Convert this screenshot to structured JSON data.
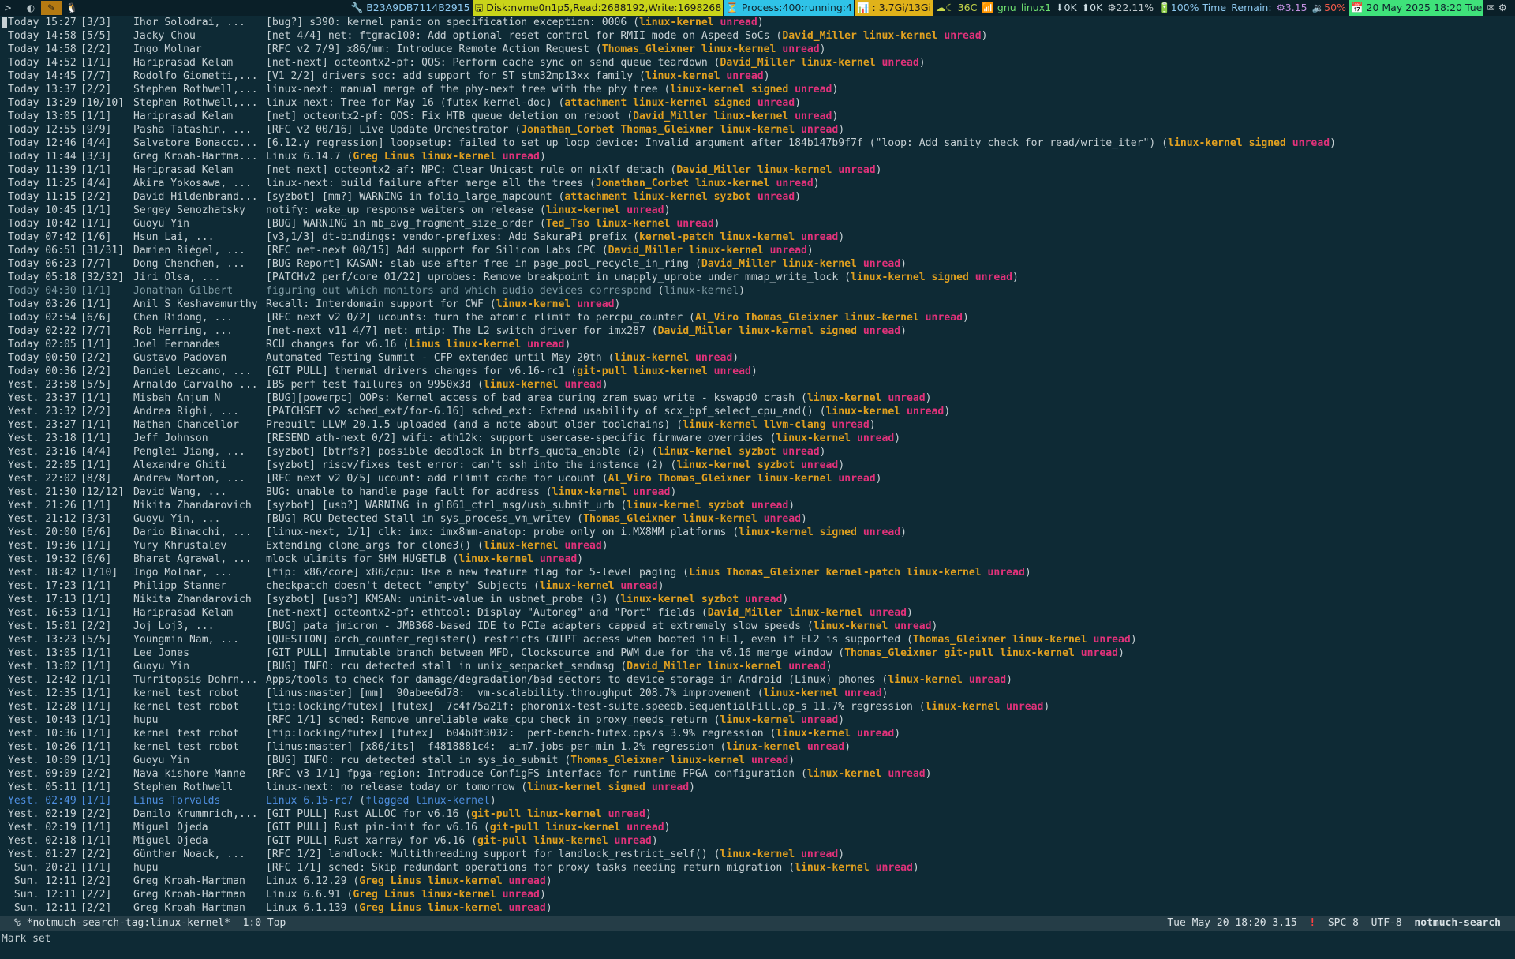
{
  "topbar": {
    "icons": [
      "terminal-icon",
      "emacs-icon",
      "firefox-icon",
      "penguin-icon"
    ],
    "icon_glyphs": [
      ">_",
      "◐",
      "✎",
      "🐧"
    ],
    "status": {
      "sha": "🔧 B23A9DB7114B2915",
      "disk": "🖫 Disk:nvme0n1p5,Read:2688192,Write:1698268",
      "process": "⏳ Process:400:running:4",
      "memory": "📊 : 3.7Gi/13Gi",
      "temp": "☁☾ 36C",
      "network": "📶 gnu_linux1",
      "down": "⬇0K",
      "up": "⬆0K",
      "cpu": "⚙22.11%",
      "battery": "🔋100% Time_Remain:",
      "load": "⚙3.15",
      "volume": "🔉50%",
      "date": "📅 20 May 2025 18:20 Tue",
      "mail": "✉ ⚙"
    }
  },
  "threads": [
    {
      "date": "Today 15:27",
      "count": "[3/3]",
      "author": "Ihor Solodrai, ...",
      "subject": "[bug?] s390: kernel panic on specification exception: 0006",
      "tags": [
        "linux-kernel",
        "unread"
      ]
    },
    {
      "date": "Today 14:58",
      "count": "[5/5]",
      "author": "Jacky Chou",
      "subject": "[net 4/4] net: ftgmac100: Add optional reset control for RMII mode on Aspeed SoCs",
      "tags": [
        "David_Miller",
        "linux-kernel",
        "unread"
      ]
    },
    {
      "date": "Today 14:58",
      "count": "[2/2]",
      "author": "Ingo Molnar",
      "subject": "[RFC v2 7/9] x86/mm: Introduce Remote Action Request",
      "tags": [
        "Thomas_Gleixner",
        "linux-kernel",
        "unread"
      ]
    },
    {
      "date": "Today 14:52",
      "count": "[1/1]",
      "author": "Hariprasad Kelam",
      "subject": "[net-next] octeontx2-pf: QOS: Perform cache sync on send queue teardown",
      "tags": [
        "David_Miller",
        "linux-kernel",
        "unread"
      ]
    },
    {
      "date": "Today 14:45",
      "count": "[7/7]",
      "author": "Rodolfo Giometti,...",
      "subject": "[V1 2/2] drivers soc: add support for ST stm32mp13xx family",
      "tags": [
        "linux-kernel",
        "unread"
      ]
    },
    {
      "date": "Today 13:37",
      "count": "[2/2]",
      "author": "Stephen Rothwell,...",
      "subject": "linux-next: manual merge of the phy-next tree with the phy tree",
      "tags": [
        "linux-kernel",
        "signed",
        "unread"
      ]
    },
    {
      "date": "Today 13:29",
      "count": "[10/10]",
      "author": "Stephen Rothwell,...",
      "subject": "linux-next: Tree for May 16 (futex kernel-doc)",
      "tags": [
        "attachment",
        "linux-kernel",
        "signed",
        "unread"
      ]
    },
    {
      "date": "Today 13:05",
      "count": "[1/1]",
      "author": "Hariprasad Kelam",
      "subject": "[net] octeontx2-pf: QOS: Fix HTB queue deletion on reboot",
      "tags": [
        "David_Miller",
        "linux-kernel",
        "unread"
      ]
    },
    {
      "date": "Today 12:55",
      "count": "[9/9]",
      "author": "Pasha Tatashin, ...",
      "subject": "[RFC v2 00/16] Live Update Orchestrator",
      "tags": [
        "Jonathan_Corbet",
        "Thomas_Gleixner",
        "linux-kernel",
        "unread"
      ]
    },
    {
      "date": "Today 12:46",
      "count": "[4/4]",
      "author": "Salvatore Bonacco...",
      "subject": "[6.12.y regression] loopsetup: failed to set up loop device: Invalid argument after 184b147b9f7f (\"loop: Add sanity check for read/write_iter\")",
      "tags": [
        "linux-kernel",
        "signed",
        "unread"
      ]
    },
    {
      "date": "Today 11:44",
      "count": "[3/3]",
      "author": "Greg Kroah-Hartma...",
      "subject": "Linux 6.14.7",
      "tags": [
        "Greg",
        "Linus",
        "linux-kernel",
        "unread"
      ]
    },
    {
      "date": "Today 11:39",
      "count": "[1/1]",
      "author": "Hariprasad Kelam",
      "subject": "[net-next] octeontx2-af: NPC: Clear Unicast rule on nixlf detach",
      "tags": [
        "David_Miller",
        "linux-kernel",
        "unread"
      ]
    },
    {
      "date": "Today 11:25",
      "count": "[4/4]",
      "author": "Akira Yokosawa, ...",
      "subject": "linux-next: build failure after merge all the trees",
      "tags": [
        "Jonathan_Corbet",
        "linux-kernel",
        "unread"
      ]
    },
    {
      "date": "Today 11:15",
      "count": "[2/2]",
      "author": "David Hildenbrand...",
      "subject": "[syzbot] [mm?] WARNING in folio_large_mapcount",
      "tags": [
        "attachment",
        "linux-kernel",
        "syzbot",
        "unread"
      ]
    },
    {
      "date": "Today 10:45",
      "count": "[1/1]",
      "author": "Sergey Senozhatsky",
      "subject": "notify: wake_up response waiters on release",
      "tags": [
        "linux-kernel",
        "unread"
      ]
    },
    {
      "date": "Today 10:42",
      "count": "[1/1]",
      "author": "Guoyu Yin",
      "subject": "[BUG] WARNING in mb_avg_fragment_size_order",
      "tags": [
        "Ted_Tso",
        "linux-kernel",
        "unread"
      ]
    },
    {
      "date": "Today 07:42",
      "count": "[1/6]",
      "author": "Hsun Lai, ...",
      "subject": "[v3,1/3] dt-bindings: vendor-prefixes: Add SakuraPi prefix",
      "tags": [
        "kernel-patch",
        "linux-kernel",
        "unread"
      ]
    },
    {
      "date": "Today 06:51",
      "count": "[31/31]",
      "author": "Damien Riégel, ...",
      "subject": "[RFC net-next 00/15] Add support for Silicon Labs CPC",
      "tags": [
        "David_Miller",
        "linux-kernel",
        "unread"
      ]
    },
    {
      "date": "Today 06:23",
      "count": "[7/7]",
      "author": "Dong Chenchen, ...",
      "subject": "[BUG Report] KASAN: slab-use-after-free in page_pool_recycle_in_ring",
      "tags": [
        "David_Miller",
        "linux-kernel",
        "unread"
      ]
    },
    {
      "date": "Today 05:18",
      "count": "[32/32]",
      "author": "Jiri Olsa, ...",
      "subject": "[PATCHv2 perf/core 01/22] uprobes: Remove breakpoint in unapply_uprobe under mmap_write_lock",
      "tags": [
        "linux-kernel",
        "signed",
        "unread"
      ]
    },
    {
      "date": "Today 04:30",
      "count": "[1/1]",
      "author": "Jonathan Gilbert",
      "subject": "figuring out which monitors and which audio devices correspond",
      "tags": [
        "linux-kernel"
      ],
      "style": "dim"
    },
    {
      "date": "Today 03:26",
      "count": "[1/1]",
      "author": "Anil S Keshavamurthy",
      "subject": "Recall: Interdomain support for CWF",
      "tags": [
        "linux-kernel",
        "unread"
      ]
    },
    {
      "date": "Today 02:54",
      "count": "[6/6]",
      "author": "Chen Ridong, ...",
      "subject": "[RFC next v2 0/2] ucounts: turn the atomic rlimit to percpu_counter",
      "tags": [
        "Al_Viro",
        "Thomas_Gleixner",
        "linux-kernel",
        "unread"
      ]
    },
    {
      "date": "Today 02:22",
      "count": "[7/7]",
      "author": "Rob Herring, ...",
      "subject": "[net-next v11 4/7] net: mtip: The L2 switch driver for imx287",
      "tags": [
        "David_Miller",
        "linux-kernel",
        "signed",
        "unread"
      ]
    },
    {
      "date": "Today 02:05",
      "count": "[1/1]",
      "author": "Joel Fernandes",
      "subject": "RCU changes for v6.16",
      "tags": [
        "Linus",
        "linux-kernel",
        "unread"
      ]
    },
    {
      "date": "Today 00:50",
      "count": "[2/2]",
      "author": "Gustavo Padovan",
      "subject": "Automated Testing Summit - CFP extended until May 20th",
      "tags": [
        "linux-kernel",
        "unread"
      ]
    },
    {
      "date": "Today 00:36",
      "count": "[2/2]",
      "author": "Daniel Lezcano, ...",
      "subject": "[GIT PULL] thermal drivers changes for v6.16-rc1",
      "tags": [
        "git-pull",
        "linux-kernel",
        "unread"
      ]
    },
    {
      "date": "Yest. 23:58",
      "count": "[5/5]",
      "author": "Arnaldo Carvalho ...",
      "subject": "IBS perf test failures on 9950x3d",
      "tags": [
        "linux-kernel",
        "unread"
      ]
    },
    {
      "date": "Yest. 23:37",
      "count": "[1/1]",
      "author": "Misbah Anjum N",
      "subject": "[BUG][powerpc] OOPs: Kernel access of bad area during zram swap write - kswapd0 crash",
      "tags": [
        "linux-kernel",
        "unread"
      ]
    },
    {
      "date": "Yest. 23:32",
      "count": "[2/2]",
      "author": "Andrea Righi, ...",
      "subject": "[PATCHSET v2 sched_ext/for-6.16] sched_ext: Extend usability of scx_bpf_select_cpu_and()",
      "tags": [
        "linux-kernel",
        "unread"
      ]
    },
    {
      "date": "Yest. 23:27",
      "count": "[1/1]",
      "author": "Nathan Chancellor",
      "subject": "Prebuilt LLVM 20.1.5 uploaded (and a note about older toolchains)",
      "tags": [
        "linux-kernel",
        "llvm-clang",
        "unread"
      ]
    },
    {
      "date": "Yest. 23:18",
      "count": "[1/1]",
      "author": "Jeff Johnson",
      "subject": "[RESEND ath-next 0/2] wifi: ath12k: support usercase-specific firmware overrides",
      "tags": [
        "linux-kernel",
        "unread"
      ]
    },
    {
      "date": "Yest. 23:16",
      "count": "[4/4]",
      "author": "Penglei Jiang, ...",
      "subject": "[syzbot] [btrfs?] possible deadlock in btrfs_quota_enable (2)",
      "tags": [
        "linux-kernel",
        "syzbot",
        "unread"
      ]
    },
    {
      "date": "Yest. 22:05",
      "count": "[1/1]",
      "author": "Alexandre Ghiti",
      "subject": "[syzbot] riscv/fixes test error: can't ssh into the instance (2)",
      "tags": [
        "linux-kernel",
        "syzbot",
        "unread"
      ]
    },
    {
      "date": "Yest. 22:02",
      "count": "[8/8]",
      "author": "Andrew Morton, ...",
      "subject": "[RFC next v2 0/5] ucount: add rlimit cache for ucount",
      "tags": [
        "Al_Viro",
        "Thomas_Gleixner",
        "linux-kernel",
        "unread"
      ]
    },
    {
      "date": "Yest. 21:30",
      "count": "[12/12]",
      "author": "David Wang, ...",
      "subject": "BUG: unable to handle page fault for address",
      "tags": [
        "linux-kernel",
        "unread"
      ]
    },
    {
      "date": "Yest. 21:26",
      "count": "[1/1]",
      "author": "Nikita Zhandarovich",
      "subject": "[syzbot] [usb?] WARNING in gl861_ctrl_msg/usb_submit_urb",
      "tags": [
        "linux-kernel",
        "syzbot",
        "unread"
      ]
    },
    {
      "date": "Yest. 21:12",
      "count": "[3/3]",
      "author": "Guoyu Yin, ...",
      "subject": "[BUG] RCU Detected Stall in sys_process_vm_writev",
      "tags": [
        "Thomas_Gleixner",
        "linux-kernel",
        "unread"
      ]
    },
    {
      "date": "Yest. 20:00",
      "count": "[6/6]",
      "author": "Dario Binacchi, ...",
      "subject": "[linux-next, 1/1] clk: imx: imx8mm-anatop: probe only on i.MX8MM platforms",
      "tags": [
        "linux-kernel",
        "signed",
        "unread"
      ]
    },
    {
      "date": "Yest. 19:36",
      "count": "[1/1]",
      "author": "Yury Khrustalev",
      "subject": "Extending clone_args for clone3()",
      "tags": [
        "linux-kernel",
        "unread"
      ]
    },
    {
      "date": "Yest. 19:32",
      "count": "[6/6]",
      "author": "Bharat Agrawal, ...",
      "subject": "mlock ulimits for SHM_HUGETLB",
      "tags": [
        "linux-kernel",
        "unread"
      ]
    },
    {
      "date": "Yest. 18:42",
      "count": "[1/10]",
      "author": "Ingo Molnar, ...",
      "subject": "[tip: x86/core] x86/cpu: Use a new feature flag for 5-level paging",
      "tags": [
        "Linus",
        "Thomas_Gleixner",
        "kernel-patch",
        "linux-kernel",
        "unread"
      ]
    },
    {
      "date": "Yest. 17:23",
      "count": "[1/1]",
      "author": "Philipp Stanner",
      "subject": "checkpatch doesn't detect \"empty\" Subjects",
      "tags": [
        "linux-kernel",
        "unread"
      ]
    },
    {
      "date": "Yest. 17:13",
      "count": "[1/1]",
      "author": "Nikita Zhandarovich",
      "subject": "[syzbot] [usb?] KMSAN: uninit-value in usbnet_probe (3)",
      "tags": [
        "linux-kernel",
        "syzbot",
        "unread"
      ]
    },
    {
      "date": "Yest. 16:53",
      "count": "[1/1]",
      "author": "Hariprasad Kelam",
      "subject": "[net-next] octeontx2-pf: ethtool: Display \"Autoneg\" and \"Port\" fields",
      "tags": [
        "David_Miller",
        "linux-kernel",
        "unread"
      ]
    },
    {
      "date": "Yest. 15:01",
      "count": "[2/2]",
      "author": "Joj Loj3, ...",
      "subject": "[BUG] pata_jmicron - JMB368-based IDE to PCIe adapters capped at extremely slow speeds",
      "tags": [
        "linux-kernel",
        "unread"
      ]
    },
    {
      "date": "Yest. 13:23",
      "count": "[5/5]",
      "author": "Youngmin Nam, ...",
      "subject": "[QUESTION] arch_counter_register() restricts CNTPT access when booted in EL1, even if EL2 is supported",
      "tags": [
        "Thomas_Gleixner",
        "linux-kernel",
        "unread"
      ]
    },
    {
      "date": "Yest. 13:05",
      "count": "[1/1]",
      "author": "Lee Jones",
      "subject": "[GIT PULL] Immutable branch between MFD, Clocksource and PWM due for the v6.16 merge window",
      "tags": [
        "Thomas_Gleixner",
        "git-pull",
        "linux-kernel",
        "unread"
      ]
    },
    {
      "date": "Yest. 13:02",
      "count": "[1/1]",
      "author": "Guoyu Yin",
      "subject": "[BUG] INFO: rcu detected stall in unix_seqpacket_sendmsg",
      "tags": [
        "David_Miller",
        "linux-kernel",
        "unread"
      ]
    },
    {
      "date": "Yest. 12:42",
      "count": "[1/1]",
      "author": "Turritopsis Dohrn...",
      "subject": "Apps/tools to check for damage/degradation/bad sectors to device storage in Android (Linux) phones",
      "tags": [
        "linux-kernel",
        "unread"
      ]
    },
    {
      "date": "Yest. 12:35",
      "count": "[1/1]",
      "author": "kernel test robot",
      "subject": "[linus:master] [mm]  90abee6d78:  vm-scalability.throughput 208.7% improvement",
      "tags": [
        "linux-kernel",
        "unread"
      ]
    },
    {
      "date": "Yest. 12:28",
      "count": "[1/1]",
      "author": "kernel test robot",
      "subject": "[tip:locking/futex] [futex]  7c4f75a21f: phoronix-test-suite.speedb.SequentialFill.op_s 11.7% regression",
      "tags": [
        "linux-kernel",
        "unread"
      ]
    },
    {
      "date": "Yest. 10:43",
      "count": "[1/1]",
      "author": "hupu",
      "subject": "[RFC 1/1] sched: Remove unreliable wake_cpu check in proxy_needs_return",
      "tags": [
        "linux-kernel",
        "unread"
      ]
    },
    {
      "date": "Yest. 10:36",
      "count": "[1/1]",
      "author": "kernel test robot",
      "subject": "[tip:locking/futex] [futex]  b04b8f3032:  perf-bench-futex.ops/s 3.9% regression",
      "tags": [
        "linux-kernel",
        "unread"
      ]
    },
    {
      "date": "Yest. 10:26",
      "count": "[1/1]",
      "author": "kernel test robot",
      "subject": "[linus:master] [x86/its]  f4818881c4:  aim7.jobs-per-min 1.2% regression",
      "tags": [
        "linux-kernel",
        "unread"
      ]
    },
    {
      "date": "Yest. 10:09",
      "count": "[1/1]",
      "author": "Guoyu Yin",
      "subject": "[BUG] INFO: rcu detected stall in sys_io_submit",
      "tags": [
        "Thomas_Gleixner",
        "linux-kernel",
        "unread"
      ]
    },
    {
      "date": "Yest. 09:09",
      "count": "[2/2]",
      "author": "Nava kishore Manne",
      "subject": "[RFC v3 1/1] fpga-region: Introduce ConfigFS interface for runtime FPGA configuration",
      "tags": [
        "linux-kernel",
        "unread"
      ]
    },
    {
      "date": "Yest. 05:11",
      "count": "[1/1]",
      "author": "Stephen Rothwell",
      "subject": "linux-next: no release today or tomorrow",
      "tags": [
        "linux-kernel",
        "signed",
        "unread"
      ]
    },
    {
      "date": "Yest. 02:49",
      "count": "[1/1]",
      "author": "Linus Torvalds",
      "subject": "Linux 6.15-rc7",
      "tags": [
        "flagged",
        "linux-kernel"
      ],
      "style": "flagged"
    },
    {
      "date": "Yest. 02:19",
      "count": "[2/2]",
      "author": "Danilo Krummrich,...",
      "subject": "[GIT PULL] Rust ALLOC for v6.16",
      "tags": [
        "git-pull",
        "linux-kernel",
        "unread"
      ]
    },
    {
      "date": "Yest. 02:19",
      "count": "[1/1]",
      "author": "Miguel Ojeda",
      "subject": "[GIT PULL] Rust pin-init for v6.16",
      "tags": [
        "git-pull",
        "linux-kernel",
        "unread"
      ]
    },
    {
      "date": "Yest. 02:18",
      "count": "[1/1]",
      "author": "Miguel Ojeda",
      "subject": "[GIT PULL] Rust xarray for v6.16",
      "tags": [
        "git-pull",
        "linux-kernel",
        "unread"
      ]
    },
    {
      "date": "Yest. 01:27",
      "count": "[2/2]",
      "author": "Günther Noack, ...",
      "subject": "[RFC 1/2] landlock: Multithreading support for landlock_restrict_self()",
      "tags": [
        "linux-kernel",
        "unread"
      ]
    },
    {
      "date": " Sun. 20:21",
      "count": "[1/1]",
      "author": "hupu",
      "subject": "[RFC 1/1] sched: Skip redundant operations for proxy tasks needing return migration",
      "tags": [
        "linux-kernel",
        "unread"
      ]
    },
    {
      "date": " Sun. 12:11",
      "count": "[2/2]",
      "author": "Greg Kroah-Hartman",
      "subject": "Linux 6.12.29",
      "tags": [
        "Greg",
        "Linus",
        "linux-kernel",
        "unread"
      ]
    },
    {
      "date": " Sun. 12:11",
      "count": "[2/2]",
      "author": "Greg Kroah-Hartman",
      "subject": "Linux 6.6.91",
      "tags": [
        "Greg",
        "Linus",
        "linux-kernel",
        "unread"
      ]
    },
    {
      "date": " Sun. 12:11",
      "count": "[2/2]",
      "author": "Greg Kroah-Hartman",
      "subject": "Linux 6.1.139",
      "tags": [
        "Greg",
        "Linus",
        "linux-kernel",
        "unread"
      ]
    }
  ],
  "modeline": {
    "buffer": "% *notmuch-search-tag:linux-kernel*  1:0 Top",
    "datetime": "Tue May 20 18:20 3.15",
    "warning": "!",
    "indent": "SPC 8",
    "encoding": "UTF-8",
    "mode": "notmuch-search"
  },
  "echo_area": "Mark set",
  "colors": {
    "background": "#0e2a35",
    "tag": "#e0a020",
    "unread": "#e0327a",
    "flagged": "#4f8fe0",
    "modeline_bg": "#253d47"
  }
}
